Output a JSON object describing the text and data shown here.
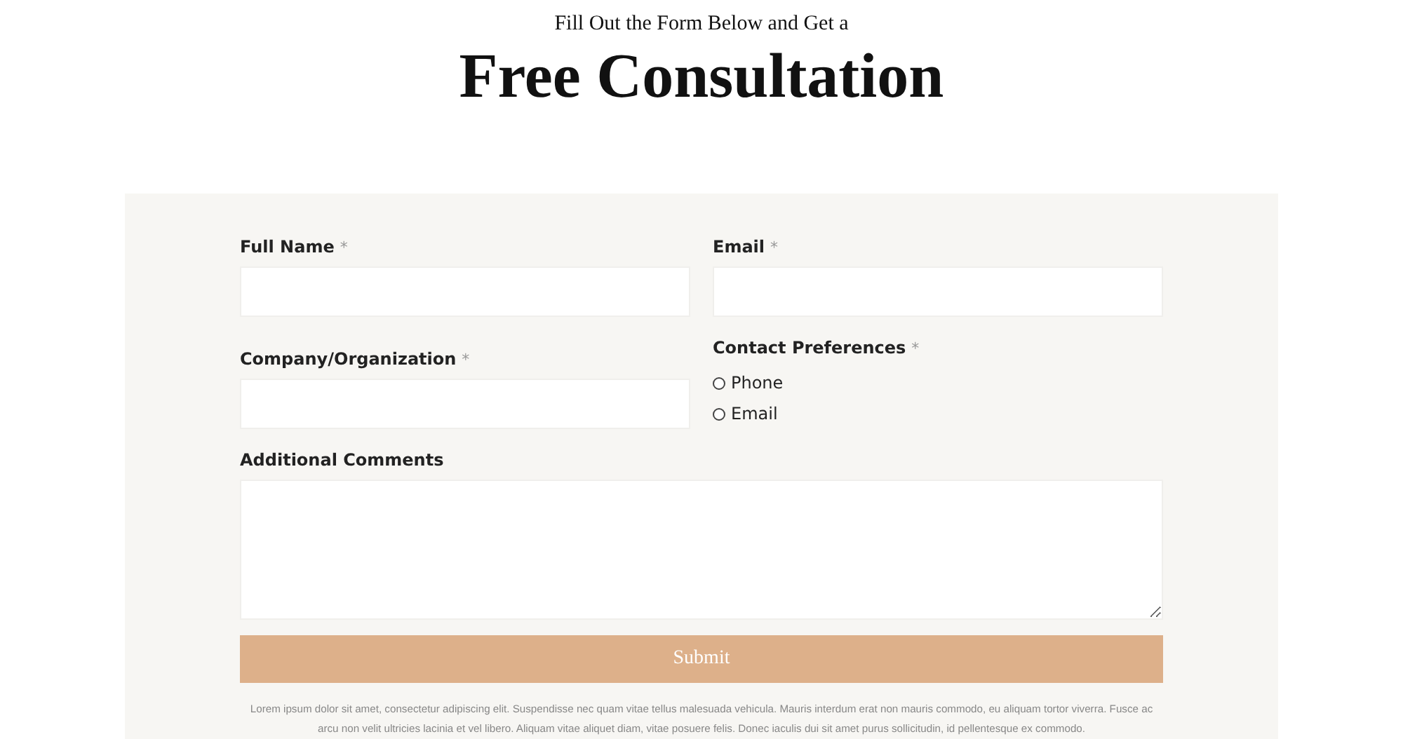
{
  "header": {
    "subtitle": "Fill Out the Form Below and Get a",
    "title": "Free Consultation"
  },
  "form": {
    "fields": [
      {
        "kind": "text",
        "label": "Full Name",
        "marker": "*"
      },
      {
        "kind": "text",
        "label": "Email",
        "marker": "*"
      },
      {
        "kind": "radio",
        "label": "Contact Preferences",
        "marker": "*",
        "options": [
          {
            "label": "Phone",
            "selected": false
          },
          {
            "label": "Email",
            "selected": false
          }
        ]
      },
      {
        "kind": "text",
        "label": "Company/Organization",
        "marker": "*"
      },
      {
        "kind": "textarea",
        "label": "Additional Comments"
      }
    ],
    "submit": "Submit",
    "disclaimer": "Lorem ipsum dolor sit amet, consectetur adipiscing elit. Suspendisse nec quam vitae tellus malesuada vehicula. Mauris interdum erat non mauris commodo, eu aliquam tortor viverra. Fusce ac arcu non velit ultricies lacinia et vel libero. Aliquam vitae aliquet diam, vitae posuere felis. Donec iaculis dui sit amet purus sollicitudin, id pellentesque ex commodo."
  }
}
